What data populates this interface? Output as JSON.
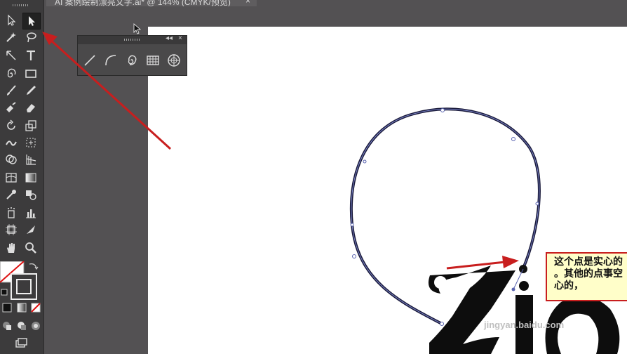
{
  "document_tab": {
    "title": "AI 案例绘制漂亮文字.ai* @ 144% (CMYK/预览)",
    "close": "×"
  },
  "toolbar": {
    "tools": [
      {
        "name": "selection-tool",
        "active": false
      },
      {
        "name": "direct-selection-tool",
        "active": true
      },
      {
        "name": "magic-wand-tool",
        "active": false
      },
      {
        "name": "lasso-tool",
        "active": false
      },
      {
        "name": "pen-tool",
        "active": false
      },
      {
        "name": "type-tool",
        "active": false
      },
      {
        "name": "spiral-tool",
        "active": false
      },
      {
        "name": "rectangle-tool",
        "active": false
      },
      {
        "name": "paintbrush-tool",
        "active": false
      },
      {
        "name": "pencil-tool",
        "active": false
      },
      {
        "name": "blob-brush-tool",
        "active": false
      },
      {
        "name": "eraser-tool",
        "active": false
      },
      {
        "name": "rotate-tool",
        "active": false
      },
      {
        "name": "scale-tool",
        "active": false
      },
      {
        "name": "warp-tool",
        "active": false
      },
      {
        "name": "free-transform-tool",
        "active": false
      },
      {
        "name": "shape-builder-tool",
        "active": false
      },
      {
        "name": "perspective-grid-tool",
        "active": false
      },
      {
        "name": "mesh-tool",
        "active": false
      },
      {
        "name": "gradient-tool",
        "active": false
      },
      {
        "name": "eyedropper-tool",
        "active": false
      },
      {
        "name": "blend-tool",
        "active": false
      },
      {
        "name": "symbol-sprayer-tool",
        "active": false
      },
      {
        "name": "column-graph-tool",
        "active": false
      },
      {
        "name": "artboard-tool",
        "active": false
      },
      {
        "name": "slice-tool",
        "active": false
      },
      {
        "name": "hand-tool",
        "active": false
      },
      {
        "name": "zoom-tool",
        "active": false
      }
    ]
  },
  "line_palette": {
    "collapse": "◂◂",
    "close": "×",
    "tools": [
      "line-segment-tool",
      "arc-tool",
      "spiral-tool",
      "rectangular-grid-tool",
      "polar-grid-tool"
    ]
  },
  "callout": {
    "lines": [
      "这个点是实心的",
      "。其他的点事空",
      "心的，"
    ]
  },
  "artwork_text": "Zio",
  "watermark": "jingyan.baidu.com",
  "colors": {
    "toolbar_bg": "#3c3b3c",
    "workspace_bg": "#535153",
    "canvas_bg": "#ffffff",
    "arrow_red": "#c81e1e",
    "path_stroke": "#1a1a3a",
    "callout_bg": "#fffec9"
  }
}
